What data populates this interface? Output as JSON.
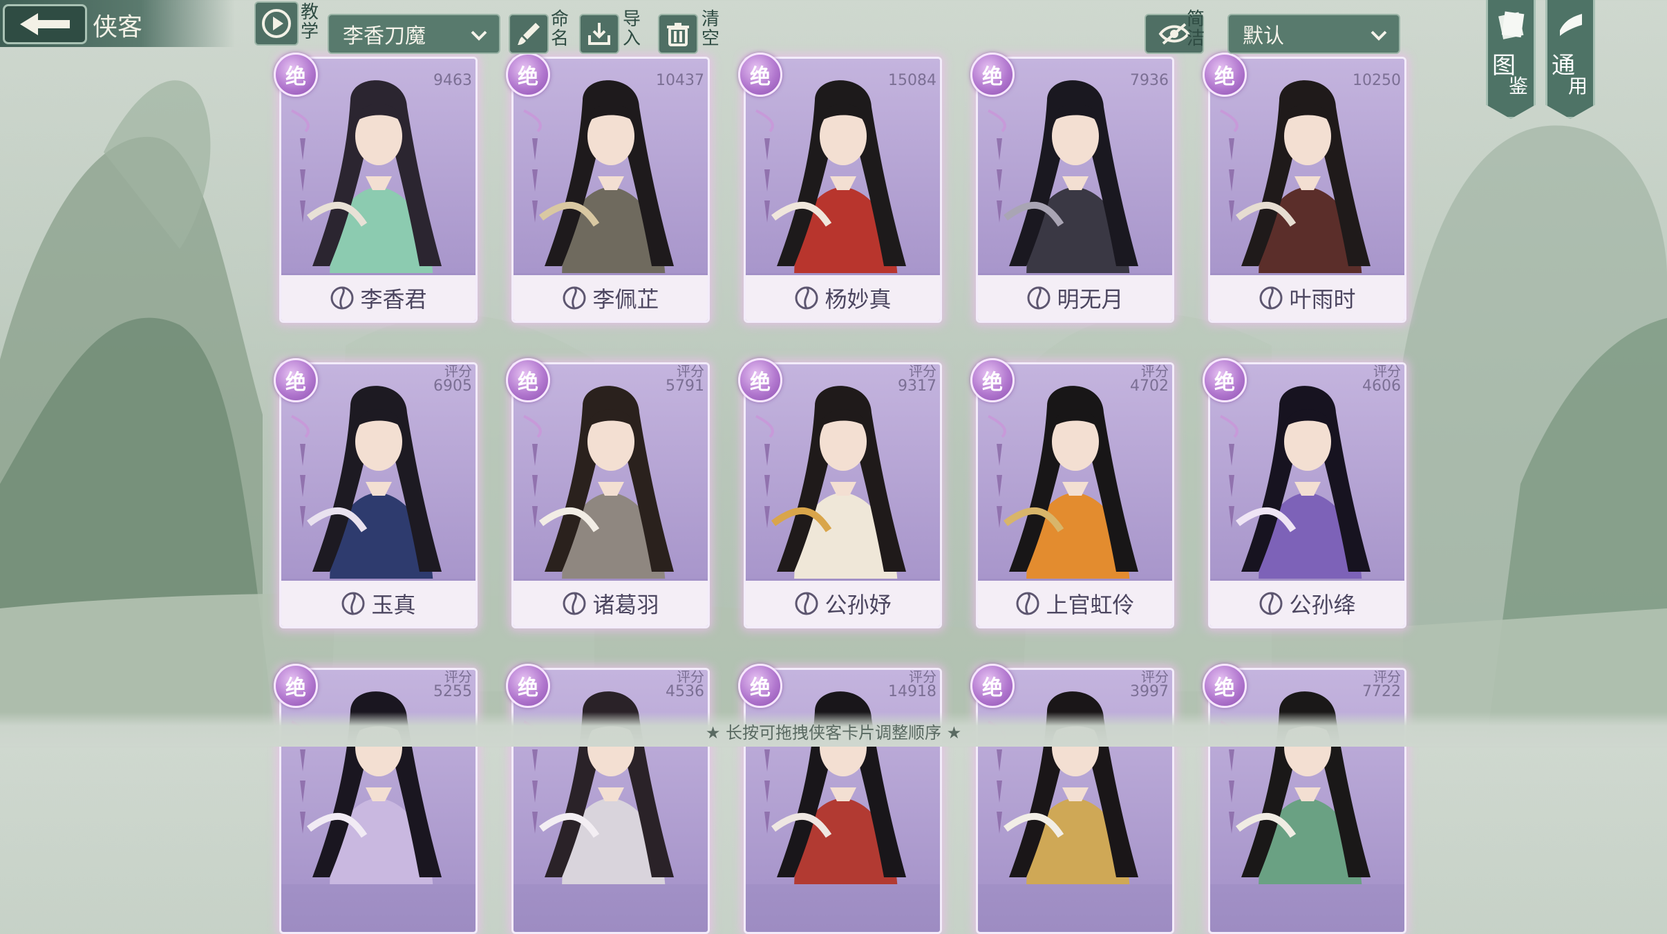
{
  "header": {
    "title": "侠客",
    "tutorial_label": "教学",
    "preset_select": "李香刀魔",
    "rename_label": "命名",
    "import_label": "导入",
    "clear_label": "清空",
    "simple_label": "简洁",
    "sort_select": "默认",
    "codex_label": "图鉴",
    "general_label": "通用"
  },
  "colors": {
    "accent_green": "#4f6f64",
    "card_purple": "#a795cb",
    "badge_purple": "#b278cf"
  },
  "cards": [
    {
      "name": "李香君",
      "rank": "绝",
      "score_label": "",
      "score": "9463",
      "school_icon": "lotus-icon"
    },
    {
      "name": "李佩芷",
      "rank": "绝",
      "score_label": "",
      "score": "10437",
      "school_icon": "taiji-icon"
    },
    {
      "name": "杨妙真",
      "rank": "绝",
      "score_label": "",
      "score": "15084",
      "school_icon": "taiji-icon"
    },
    {
      "name": "明无月",
      "rank": "绝",
      "score_label": "",
      "score": "7936",
      "school_icon": "sword-icon"
    },
    {
      "name": "叶雨时",
      "rank": "绝",
      "score_label": "",
      "score": "10250",
      "school_icon": "shield-icon"
    },
    {
      "name": "玉真",
      "rank": "绝",
      "score_label": "评分",
      "score": "6905",
      "school_icon": "sword-icon"
    },
    {
      "name": "诸葛羽",
      "rank": "绝",
      "score_label": "评分",
      "score": "5791",
      "school_icon": "sword-icon"
    },
    {
      "name": "公孙妤",
      "rank": "绝",
      "score_label": "评分",
      "score": "9317",
      "school_icon": "lotus-icon"
    },
    {
      "name": "上官虹伶",
      "rank": "绝",
      "score_label": "评分",
      "score": "4702",
      "school_icon": "taiji-icon"
    },
    {
      "name": "公孙绛",
      "rank": "绝",
      "score_label": "评分",
      "score": "4606",
      "school_icon": "sword-icon"
    },
    {
      "name": "",
      "rank": "绝",
      "score_label": "评分",
      "score": "5255",
      "school_icon": ""
    },
    {
      "name": "",
      "rank": "绝",
      "score_label": "评分",
      "score": "4536",
      "school_icon": ""
    },
    {
      "name": "",
      "rank": "绝",
      "score_label": "评分",
      "score": "14918",
      "school_icon": ""
    },
    {
      "name": "",
      "rank": "绝",
      "score_label": "评分",
      "score": "3997",
      "school_icon": ""
    },
    {
      "name": "",
      "rank": "绝",
      "score_label": "评分",
      "score": "7722",
      "school_icon": ""
    }
  ],
  "footer": {
    "hint": "★ 长按可拖拽侠客卡片调整顺序 ★"
  }
}
